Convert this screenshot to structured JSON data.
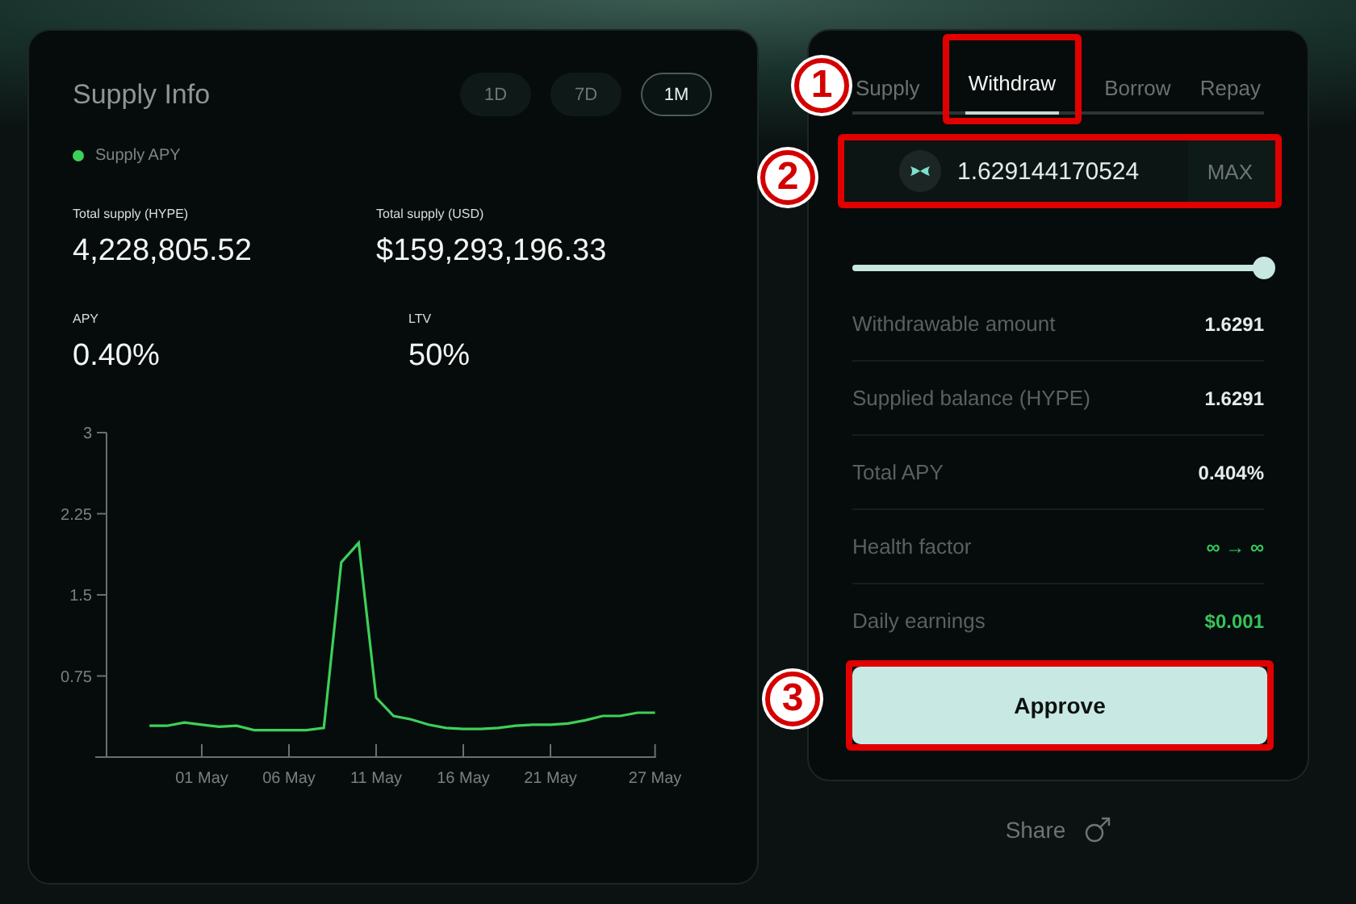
{
  "supply_info": {
    "title": "Supply Info",
    "ranges": [
      {
        "label": "1D",
        "selected": false
      },
      {
        "label": "7D",
        "selected": false
      },
      {
        "label": "1M",
        "selected": true
      }
    ],
    "stats": [
      {
        "label": "Total supply (HYPE)",
        "value": "4,228,805.52"
      },
      {
        "label": "Total supply (USD)",
        "value": "$159,293,196.33"
      },
      {
        "label": "APY",
        "value": "0.40%"
      },
      {
        "label": "LTV",
        "value": "50%"
      }
    ],
    "chart_data": {
      "type": "line",
      "categories": [
        null,
        null,
        null,
        "01 May",
        null,
        null,
        null,
        null,
        "06 May",
        null,
        null,
        null,
        null,
        "11 May",
        null,
        null,
        null,
        null,
        "16 May",
        null,
        null,
        null,
        null,
        "21 May",
        null,
        null,
        null,
        null,
        null,
        "27 May"
      ],
      "series": [
        {
          "name": "Supply APY",
          "color": "#3ecf5a",
          "values": [
            0.29,
            0.29,
            0.32,
            0.3,
            0.28,
            0.29,
            0.25,
            0.25,
            0.25,
            0.25,
            0.27,
            1.8,
            1.98,
            0.55,
            0.38,
            0.35,
            0.3,
            0.27,
            0.26,
            0.26,
            0.27,
            0.29,
            0.3,
            0.3,
            0.31,
            0.34,
            0.38,
            0.38,
            0.41,
            0.41
          ]
        }
      ],
      "ylim": [
        0,
        3
      ],
      "yticks": [
        {
          "value": 0.75,
          "label": "0.75"
        },
        {
          "value": 1.5,
          "label": "1.5"
        },
        {
          "value": 2.25,
          "label": "2.25"
        },
        {
          "value": 3,
          "label": "3"
        }
      ]
    }
  },
  "action": {
    "tabs": [
      {
        "label": "Supply",
        "selected": false
      },
      {
        "label": "Withdraw",
        "selected": true
      },
      {
        "label": "Borrow",
        "selected": false
      },
      {
        "label": "Repay",
        "selected": false
      }
    ],
    "amount": {
      "value": "1.629144170524",
      "max": "MAX"
    },
    "slider": {
      "level": 1
    },
    "rows": [
      {
        "label": "Withdrawable amount",
        "value": "1.6291",
        "color": "#e6eceb"
      },
      {
        "label": "Supplied balance (HYPE)",
        "value": "1.6291",
        "color": "#e6eceb"
      },
      {
        "label": "Total APY",
        "value": "0.404%",
        "color": "#e6eceb"
      },
      {
        "label": "Health factor",
        "value": "∞ → ∞",
        "color": "#36c35a"
      },
      {
        "label": "Daily earnings",
        "value": "$0.001",
        "color": "#36c35a"
      }
    ],
    "button": "Approve"
  },
  "share": "Share",
  "annotations": [
    {
      "label": "1"
    },
    {
      "label": "2"
    },
    {
      "label": "3"
    }
  ]
}
